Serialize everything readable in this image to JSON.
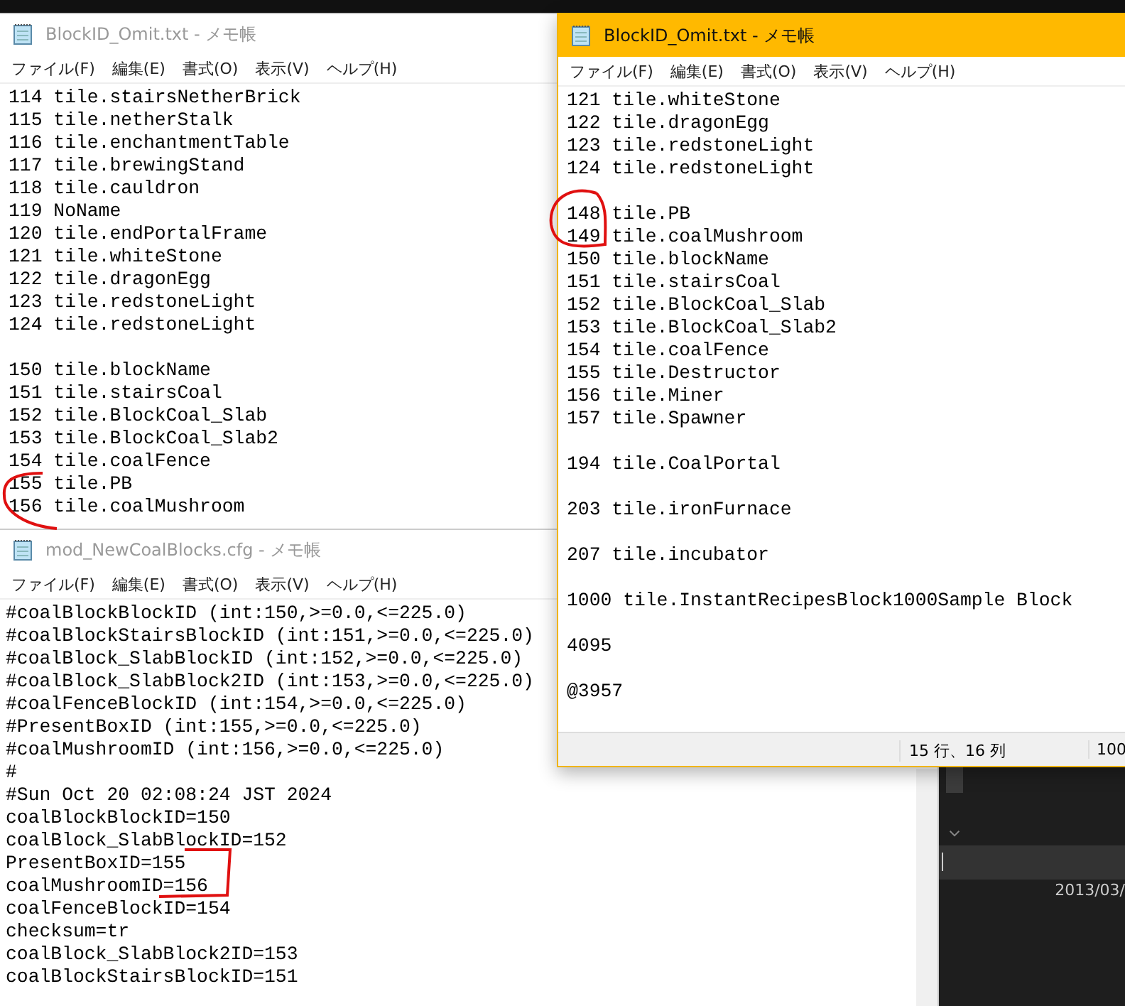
{
  "windows": [
    {
      "title": "BlockID_Omit.txt - メモ帳",
      "active": false,
      "menu": [
        "ファイル(F)",
        "編集(E)",
        "書式(O)",
        "表示(V)",
        "ヘルプ(H)"
      ],
      "blocks": [
        [
          "114 tile.stairsNetherBrick",
          "115 tile.netherStalk",
          "116 tile.enchantmentTable",
          "117 tile.brewingStand",
          "118 tile.cauldron",
          "119 NoName",
          "120 tile.endPortalFrame",
          "121 tile.whiteStone",
          "122 tile.dragonEgg",
          "123 tile.redstoneLight",
          "124 tile.redstoneLight"
        ],
        [
          "150 tile.blockName",
          "151 tile.stairsCoal",
          "152 tile.BlockCoal_Slab",
          "153 tile.BlockCoal_Slab2",
          "154 tile.coalFence",
          "155 tile.PB",
          "156 tile.coalMushroom"
        ]
      ]
    },
    {
      "title": "BlockID_Omit.txt - メモ帳",
      "active": true,
      "menu": [
        "ファイル(F)",
        "編集(E)",
        "書式(O)",
        "表示(V)",
        "ヘルプ(H)"
      ],
      "blocks": [
        [
          "121 tile.whiteStone",
          "122 tile.dragonEgg",
          "123 tile.redstoneLight",
          "124 tile.redstoneLight"
        ],
        [
          "148 tile.PB",
          "149 tile.coalMushroom",
          "150 tile.blockName",
          "151 tile.stairsCoal",
          "152 tile.BlockCoal_Slab",
          "153 tile.BlockCoal_Slab2",
          "154 tile.coalFence",
          "155 tile.Destructor",
          "156 tile.Miner",
          "157 tile.Spawner"
        ],
        [
          "194 tile.CoalPortal"
        ],
        [
          "203 tile.ironFurnace"
        ],
        [
          "207 tile.incubator"
        ],
        [
          "1000 tile.InstantRecipesBlock1000Sample Block"
        ],
        [
          "4095"
        ],
        [
          "@3957"
        ]
      ],
      "status_bar": {
        "position": "15 行、16 列",
        "zoom": "100"
      }
    },
    {
      "title": "mod_NewCoalBlocks.cfg - メモ帳",
      "active": false,
      "menu": [
        "ファイル(F)",
        "編集(E)",
        "書式(O)",
        "表示(V)",
        "ヘルプ(H)"
      ],
      "blocks": [
        [
          "#coalBlockBlockID (int:150,>=0.0,<=225.0)",
          "#coalBlockStairsBlockID (int:151,>=0.0,<=225.0)",
          "#coalBlock_SlabBlockID (int:152,>=0.0,<=225.0)",
          "#coalBlock_SlabBlock2ID (int:153,>=0.0,<=225.0)",
          "#coalFenceBlockID (int:154,>=0.0,<=225.0)",
          "#PresentBoxID (int:155,>=0.0,<=225.0)",
          "#coalMushroomID (int:156,>=0.0,<=225.0)",
          "#",
          "#Sun Oct 20 02:08:24 JST 2024",
          "coalBlockBlockID=150",
          "coalBlock_SlabBlockID=152",
          "PresentBoxID=155",
          "coalMushroomID=156",
          "coalFenceBlockID=154",
          "checksum=tr",
          "coalBlock_SlabBlock2ID=153",
          "coalBlockStairsBlockID=151"
        ]
      ]
    }
  ],
  "side_panel": {
    "date_text": "2013/03/"
  }
}
